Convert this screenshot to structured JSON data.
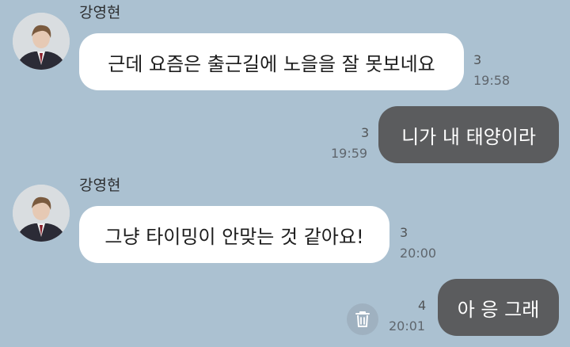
{
  "messages": [
    {
      "sender": "강영현",
      "text": "근데 요즘은 출근길에 노을을 잘 못보네요",
      "unread": "3",
      "time": "19:58"
    },
    {
      "text": "니가 내 태양이라",
      "unread": "3",
      "time": "19:59"
    },
    {
      "sender": "강영현",
      "text": "그냥 타이밍이 안맞는 것 같아요!",
      "unread": "3",
      "time": "20:00"
    },
    {
      "text": "아 응 그래",
      "unread": "4",
      "time": "20:01"
    }
  ],
  "icons": {
    "avatar": "profile-photo",
    "delete": "trash-icon"
  },
  "colors": {
    "background": "#abc1d1",
    "incoming_bubble": "#ffffff",
    "outgoing_bubble": "#5b5c5e",
    "unread_count": "#515456"
  }
}
